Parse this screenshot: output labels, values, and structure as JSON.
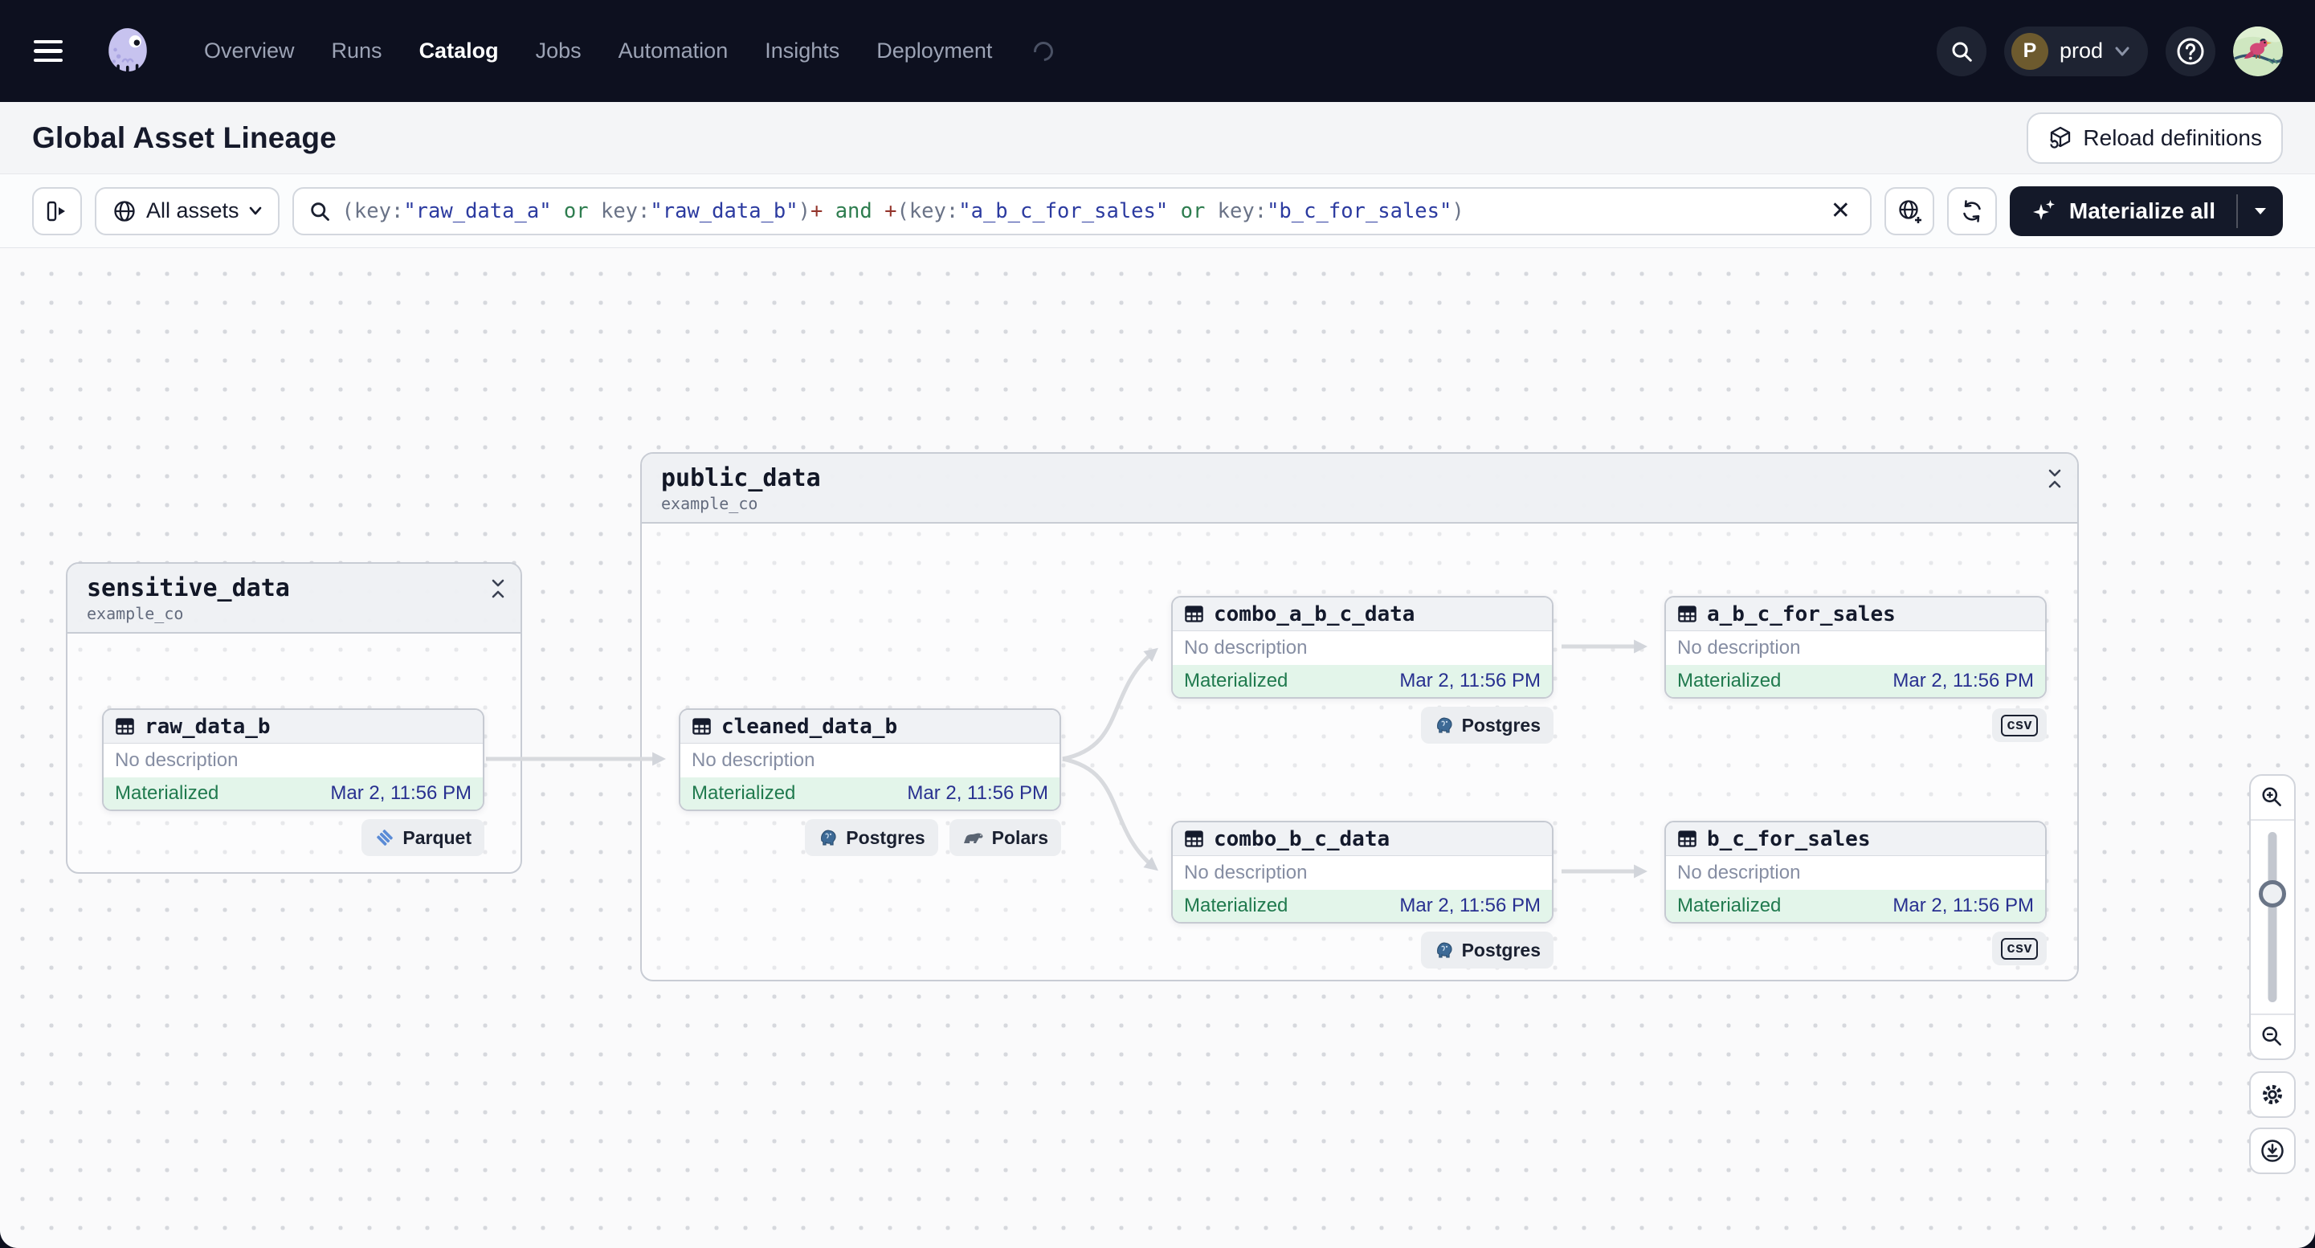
{
  "theme": {
    "green_bg": "#e3f5ea",
    "green_text": "#207a4e",
    "timestamp_blue": "#283090",
    "syntax_slate": "#6a7387",
    "syntax_string": "#2c3ba0",
    "syntax_op": "#2e7d4f",
    "syntax_plus": "#94352c",
    "nav_bg": "#0d101f",
    "dark_button_bg": "#141929"
  },
  "nav": {
    "items": [
      {
        "label": "Overview"
      },
      {
        "label": "Runs"
      },
      {
        "label": "Catalog"
      },
      {
        "label": "Jobs"
      },
      {
        "label": "Automation"
      },
      {
        "label": "Insights"
      },
      {
        "label": "Deployment"
      }
    ],
    "active_item": "Catalog",
    "env": {
      "initial": "P",
      "name": "prod"
    }
  },
  "header": {
    "title": "Global Asset Lineage",
    "reload_label": "Reload definitions"
  },
  "toolbar": {
    "scope_label": "All assets",
    "materialize_label": "Materialize all",
    "query_segments": [
      {
        "t": "(key:",
        "c": "slate"
      },
      {
        "t": "\"raw_data_a\"",
        "c": "str"
      },
      {
        "t": " or ",
        "c": "op"
      },
      {
        "t": "key:",
        "c": "slate"
      },
      {
        "t": "\"raw_data_b\"",
        "c": "str"
      },
      {
        "t": ")",
        "c": "slate"
      },
      {
        "t": "+",
        "c": "plus"
      },
      {
        "t": " and ",
        "c": "op"
      },
      {
        "t": "+",
        "c": "plus"
      },
      {
        "t": "(key:",
        "c": "slate"
      },
      {
        "t": "\"a_b_c_for_sales\"",
        "c": "str"
      },
      {
        "t": " or ",
        "c": "op"
      },
      {
        "t": "key:",
        "c": "slate"
      },
      {
        "t": "\"b_c_for_sales\"",
        "c": "str"
      },
      {
        "t": ")",
        "c": "slate"
      }
    ]
  },
  "graph": {
    "groups": [
      {
        "name": "sensitive_data",
        "subtitle": "example_co"
      },
      {
        "name": "public_data",
        "subtitle": "example_co"
      }
    ],
    "nodes": [
      {
        "name": "raw_data_b",
        "description": "No description",
        "status": "Materialized",
        "timestamp": "Mar 2, 11:56 PM",
        "tags": [
          {
            "label": "Parquet"
          }
        ]
      },
      {
        "name": "cleaned_data_b",
        "description": "No description",
        "status": "Materialized",
        "timestamp": "Mar 2, 11:56 PM",
        "tags": [
          {
            "label": "Postgres"
          },
          {
            "label": "Polars"
          }
        ]
      },
      {
        "name": "combo_a_b_c_data",
        "description": "No description",
        "status": "Materialized",
        "timestamp": "Mar 2, 11:56 PM",
        "tags": [
          {
            "label": "Postgres"
          }
        ]
      },
      {
        "name": "a_b_c_for_sales",
        "description": "No description",
        "status": "Materialized",
        "timestamp": "Mar 2, 11:56 PM",
        "tags": [
          {
            "label": "csv"
          }
        ]
      },
      {
        "name": "combo_b_c_data",
        "description": "No description",
        "status": "Materialized",
        "timestamp": "Mar 2, 11:56 PM",
        "tags": [
          {
            "label": "Postgres"
          }
        ]
      },
      {
        "name": "b_c_for_sales",
        "description": "No description",
        "status": "Materialized",
        "timestamp": "Mar 2, 11:56 PM",
        "tags": [
          {
            "label": "csv"
          }
        ]
      }
    ]
  }
}
